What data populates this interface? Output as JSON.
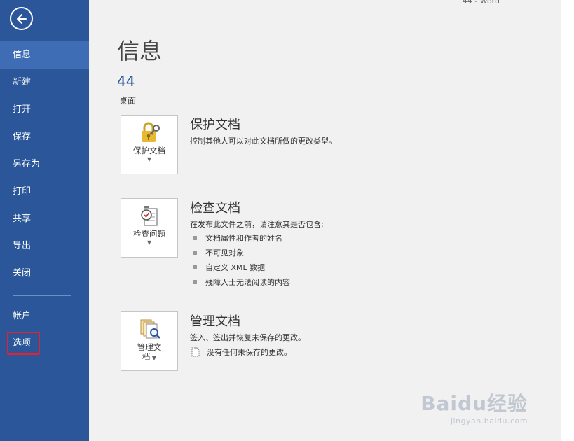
{
  "window": {
    "title": "44 - Word"
  },
  "sidebar": {
    "back_label": "←",
    "items": [
      {
        "label": "信息",
        "active": true
      },
      {
        "label": "新建"
      },
      {
        "label": "打开"
      },
      {
        "label": "保存"
      },
      {
        "label": "另存为"
      },
      {
        "label": "打印"
      },
      {
        "label": "共享"
      },
      {
        "label": "导出"
      },
      {
        "label": "关闭"
      }
    ],
    "bottom_items": [
      {
        "label": "帐户"
      },
      {
        "label": "选项",
        "highlighted": true
      }
    ],
    "background": "#2b579a",
    "active_background": "#3e6db5"
  },
  "main": {
    "title": "信息",
    "doc_name": "44",
    "doc_location": "桌面",
    "sections": {
      "protect": {
        "button_label": "保护文档",
        "icon": "lock-key-icon",
        "title": "保护文档",
        "description": "控制其他人可以对此文档所做的更改类型。"
      },
      "inspect": {
        "button_label": "检查问题",
        "icon": "checklist-icon",
        "title": "检查文档",
        "description": "在发布此文件之前，请注意其是否包含:",
        "bullets": [
          "文档属性和作者的姓名",
          "不可见对象",
          "自定义 XML 数据",
          "残障人士无法阅读的内容"
        ]
      },
      "manage": {
        "button_label_line1": "管理文",
        "button_label_line2": "档",
        "icon": "manage-document-icon",
        "title": "管理文档",
        "description": "签入、签出并恢复未保存的更改。",
        "status": "没有任何未保存的更改。"
      }
    }
  },
  "watermark": {
    "text": "Baidu经验",
    "url": "jingyan.baidu.com"
  }
}
